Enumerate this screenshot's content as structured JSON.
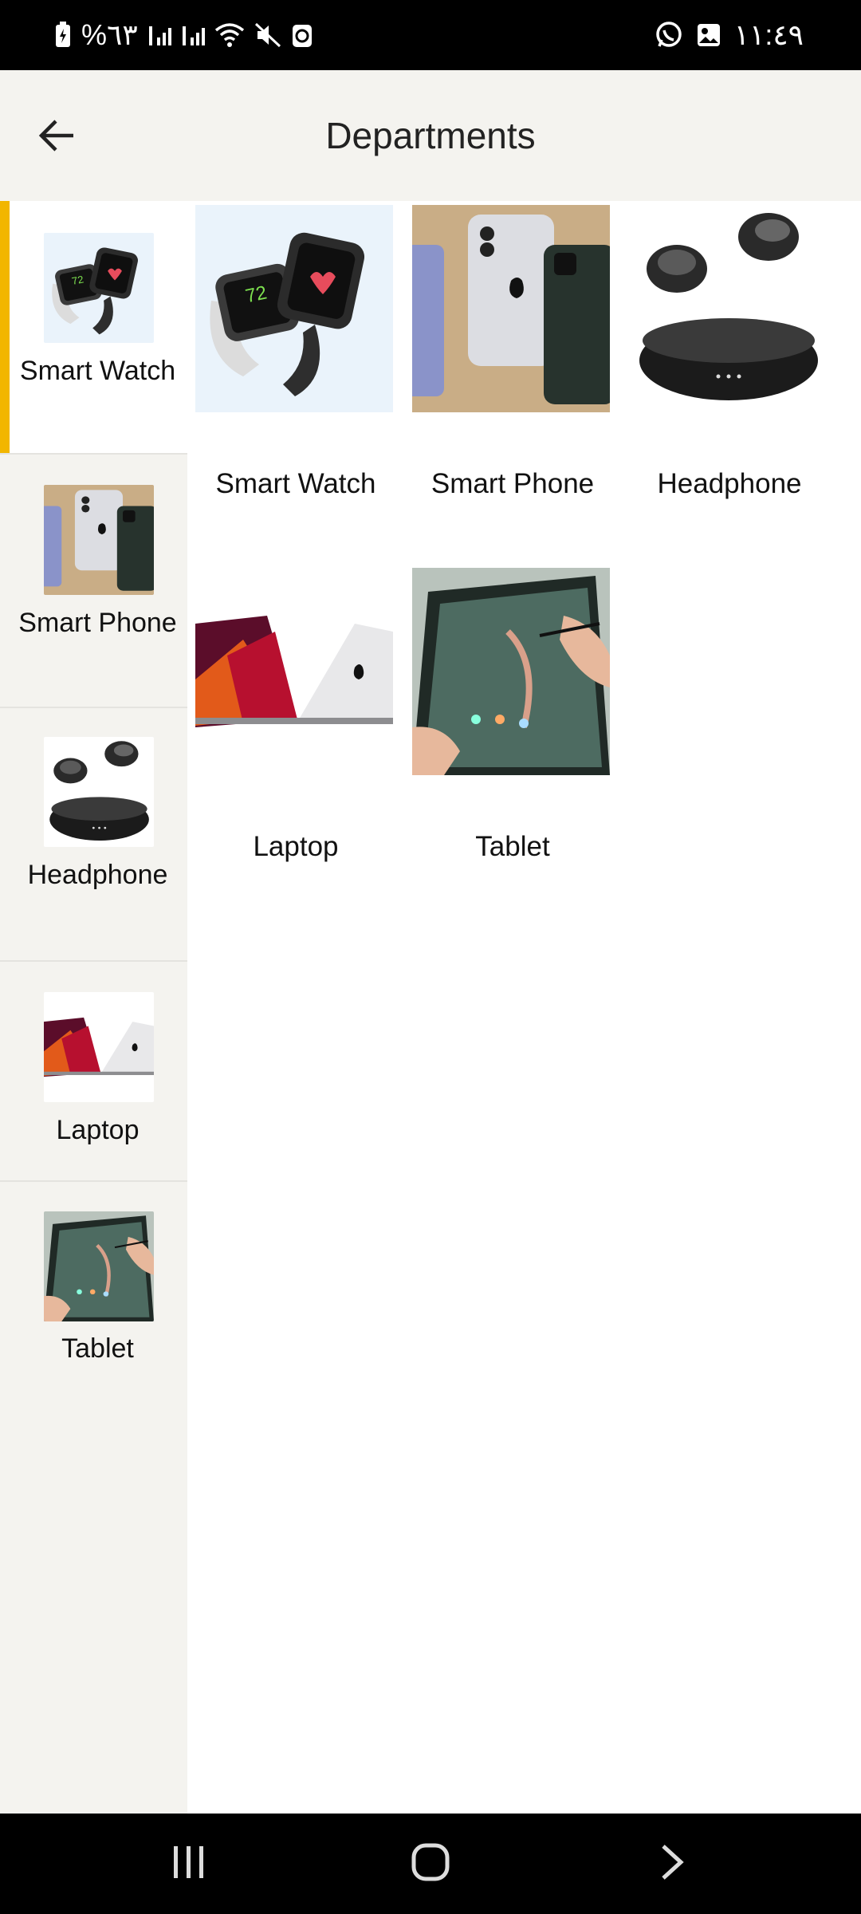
{
  "status_bar": {
    "battery_text": "%٦٣",
    "time": "١١:٤٩",
    "icons": [
      "battery-icon",
      "signal-icon",
      "signal-icon",
      "wifi-icon",
      "mute-icon",
      "recycle-icon",
      "whatsapp-icon",
      "gallery-icon"
    ]
  },
  "app_bar": {
    "title": "Departments",
    "back_icon": "arrow-left-icon"
  },
  "sidebar": {
    "accent_color": "#f2b600",
    "items": [
      {
        "label": "Smart Watch",
        "icon": "smartwatch-image",
        "active": true
      },
      {
        "label": "Smart Phone",
        "icon": "smartphone-image",
        "active": false
      },
      {
        "label": "Headphone",
        "icon": "headphone-image",
        "active": false
      },
      {
        "label": "Laptop",
        "icon": "laptop-image",
        "active": false
      },
      {
        "label": "Tablet",
        "icon": "tablet-image",
        "active": false
      }
    ]
  },
  "grid": {
    "items": [
      {
        "label": "Smart Watch",
        "icon": "smartwatch-image"
      },
      {
        "label": "Smart Phone",
        "icon": "smartphone-image"
      },
      {
        "label": "Headphone",
        "icon": "headphone-image"
      },
      {
        "label": "Laptop",
        "icon": "laptop-image"
      },
      {
        "label": "Tablet",
        "icon": "tablet-image"
      }
    ]
  },
  "nav_bar": {
    "buttons": [
      "recent-apps-icon",
      "home-icon",
      "back-chevron-icon"
    ]
  }
}
